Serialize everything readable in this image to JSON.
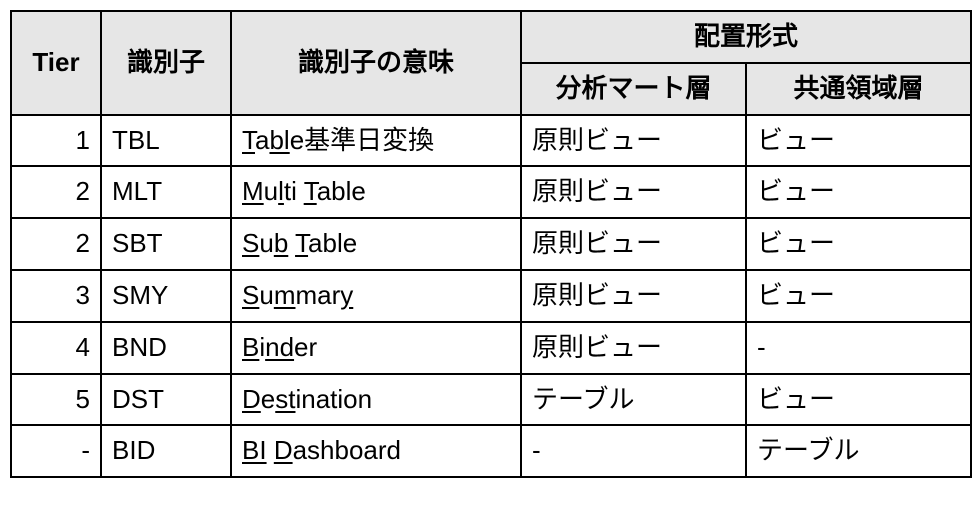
{
  "headers": {
    "tier": "Tier",
    "identifier": "識別子",
    "meaning": "識別子の意味",
    "placement_group": "配置形式",
    "placement_mart": "分析マート層",
    "placement_common": "共通領域層"
  },
  "rows": [
    {
      "tier": "1",
      "id": "TBL",
      "meaning_plain": "Table基準日変換",
      "meaning_html": "<span class=\"u\">T</span>a<span class=\"u\">bl</span>e基準日変換",
      "mart": "原則ビュー",
      "common": "ビュー"
    },
    {
      "tier": "2",
      "id": "MLT",
      "meaning_plain": "Multi Table",
      "meaning_html": "<span class=\"u\">M</span>u<span class=\"u\">l</span>ti <span class=\"u\">T</span>able",
      "mart": "原則ビュー",
      "common": "ビュー"
    },
    {
      "tier": "2",
      "id": "SBT",
      "meaning_plain": "Sub Table",
      "meaning_html": "<span class=\"u\">S</span>u<span class=\"u\">b</span> <span class=\"u\">T</span>able",
      "mart": "原則ビュー",
      "common": "ビュー"
    },
    {
      "tier": "3",
      "id": "SMY",
      "meaning_plain": "Summary",
      "meaning_html": "<span class=\"u\">S</span>u<span class=\"u\">m</span>mar<span class=\"u\">y</span>",
      "mart": "原則ビュー",
      "common": "ビュー"
    },
    {
      "tier": "4",
      "id": "BND",
      "meaning_plain": "Binder",
      "meaning_html": "<span class=\"u\">B</span>i<span class=\"u\">nd</span>er",
      "mart": "原則ビュー",
      "common": "-"
    },
    {
      "tier": "5",
      "id": "DST",
      "meaning_plain": "Destination",
      "meaning_html": "<span class=\"u\">D</span>e<span class=\"u\">st</span>ination",
      "mart": "テーブル",
      "common": "ビュー"
    },
    {
      "tier": "-",
      "id": "BID",
      "meaning_plain": "BI Dashboard",
      "meaning_html": "<span class=\"u\">BI</span> <span class=\"u\">D</span>ashboard",
      "mart": "-",
      "common": "テーブル"
    }
  ],
  "chart_data": {
    "type": "table",
    "columns": [
      "Tier",
      "識別子",
      "識別子の意味",
      "配置形式 / 分析マート層",
      "配置形式 / 共通領域層"
    ],
    "rows": [
      [
        "1",
        "TBL",
        "Table基準日変換",
        "原則ビュー",
        "ビュー"
      ],
      [
        "2",
        "MLT",
        "Multi Table",
        "原則ビュー",
        "ビュー"
      ],
      [
        "2",
        "SBT",
        "Sub Table",
        "原則ビュー",
        "ビュー"
      ],
      [
        "3",
        "SMY",
        "Summary",
        "原則ビュー",
        "ビュー"
      ],
      [
        "4",
        "BND",
        "Binder",
        "原則ビュー",
        "-"
      ],
      [
        "5",
        "DST",
        "Destination",
        "テーブル",
        "ビュー"
      ],
      [
        "-",
        "BID",
        "BI Dashboard",
        "-",
        "テーブル"
      ]
    ]
  }
}
